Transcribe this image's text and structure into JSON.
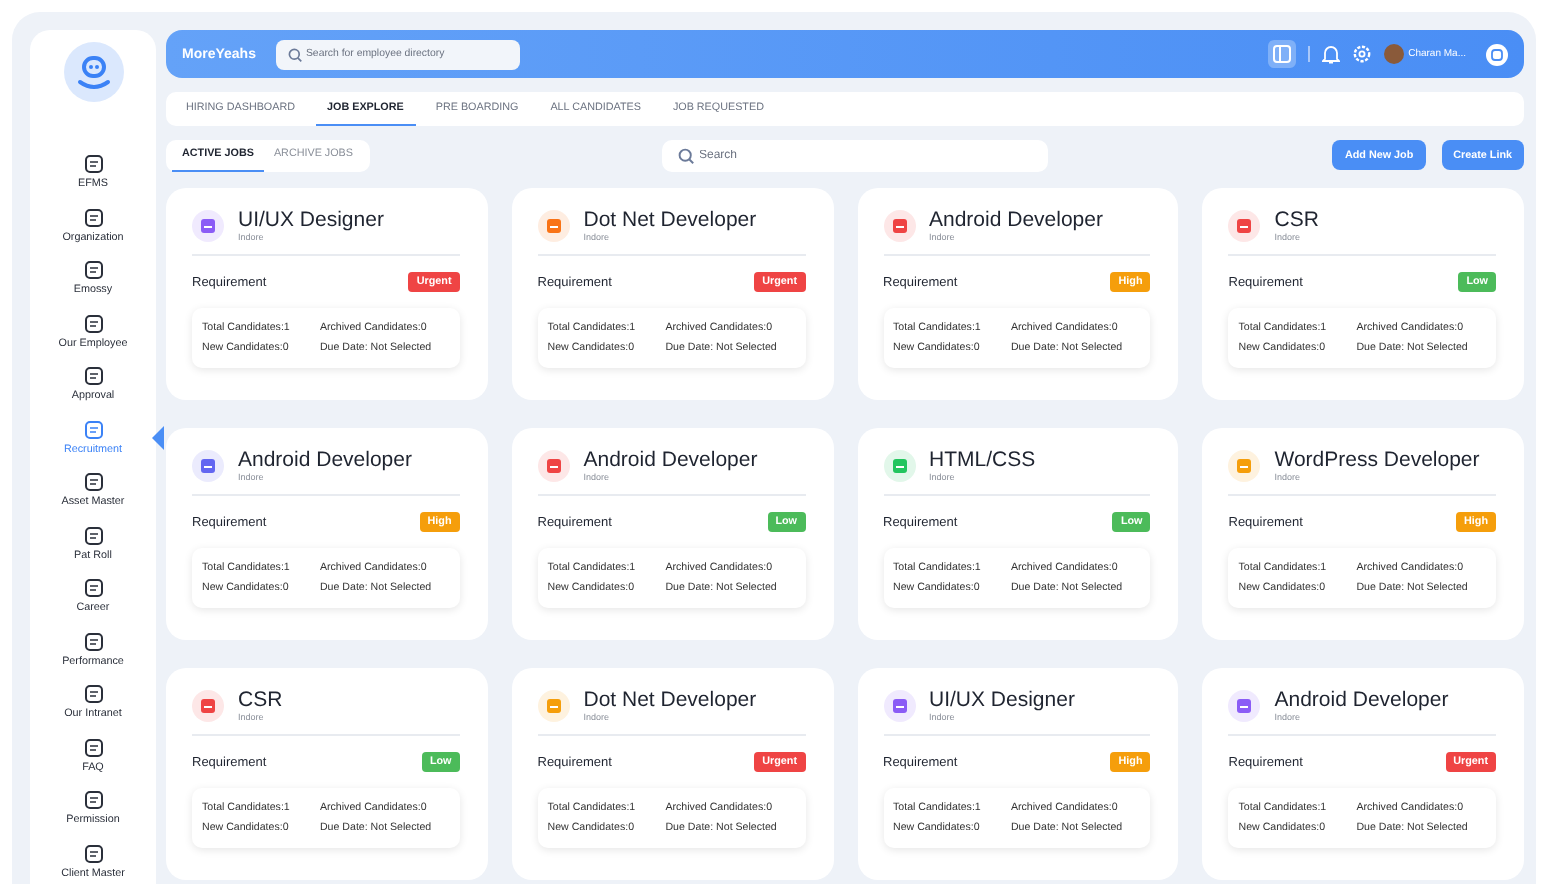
{
  "sidebar": {
    "items": [
      {
        "label": "EFMS",
        "selected": false
      },
      {
        "label": "Organization",
        "selected": false
      },
      {
        "label": "Emossy",
        "selected": false
      },
      {
        "label": "Our Employee",
        "selected": false
      },
      {
        "label": "Approval",
        "selected": false
      },
      {
        "label": "Recruitment",
        "selected": true
      },
      {
        "label": "Asset Master",
        "selected": false
      },
      {
        "label": "Pat Roll",
        "selected": false
      },
      {
        "label": "Career",
        "selected": false
      },
      {
        "label": "Performance",
        "selected": false
      },
      {
        "label": "Our Intranet",
        "selected": false
      },
      {
        "label": "FAQ",
        "selected": false
      },
      {
        "label": "Permission",
        "selected": false
      },
      {
        "label": "Client Master",
        "selected": false
      }
    ]
  },
  "header": {
    "brand": "MoreYeahs",
    "search": {
      "placeholder": "Search for employee directory"
    },
    "user_name": "Charan Ma..."
  },
  "tabs": [
    {
      "label": "HIRING DASHBOARD",
      "selected": false
    },
    {
      "label": "JOB EXPLORE",
      "selected": true
    },
    {
      "label": "PRE BOARDING",
      "selected": false
    },
    {
      "label": "ALL CANDIDATES",
      "selected": false
    },
    {
      "label": "JOB REQUESTED",
      "selected": false
    }
  ],
  "subtabs": [
    {
      "label": "ACTIVE JOBS",
      "selected": true
    },
    {
      "label": "ARCHIVE JOBS",
      "selected": false
    }
  ],
  "search": {
    "placeholder": "Search"
  },
  "buttons": [
    "Add New Job",
    "Create Link"
  ],
  "jobs": [
    {
      "title": "UI/UX Designer",
      "location": "Indore",
      "color": "#8b5cf6",
      "requirement": "Requirement",
      "priority": {
        "label": "Urgent",
        "kind": "urgent"
      },
      "stats": [
        "Total Candidates:1",
        "Archived Candidates:0",
        "New Candidates:0",
        "Due Date:  Not Selected"
      ]
    },
    {
      "title": "Dot Net Developer",
      "location": "Indore",
      "color": "#f97316",
      "requirement": "Requirement",
      "priority": {
        "label": "Urgent",
        "kind": "urgent"
      },
      "stats": [
        "Total Candidates:1",
        "Archived Candidates:0",
        "New Candidates:0",
        "Due Date:  Not Selected"
      ]
    },
    {
      "title": "Android Developer",
      "location": "Indore",
      "color": "#ef4444",
      "requirement": "Requirement",
      "priority": {
        "label": "High",
        "kind": "high"
      },
      "stats": [
        "Total Candidates:1",
        "Archived Candidates:0",
        "New Candidates:0",
        "Due Date:  Not Selected"
      ]
    },
    {
      "title": "CSR",
      "location": "Indore",
      "color": "#ef4444",
      "requirement": "Requirement",
      "priority": {
        "label": "Low",
        "kind": "low"
      },
      "stats": [
        "Total Candidates:1",
        "Archived Candidates:0",
        "New Candidates:0",
        "Due Date:  Not Selected"
      ]
    },
    {
      "title": "Android Developer",
      "location": "Indore",
      "color": "#6366f1",
      "requirement": "Requirement",
      "priority": {
        "label": "High",
        "kind": "high"
      },
      "stats": [
        "Total Candidates:1",
        "Archived Candidates:0",
        "New Candidates:0",
        "Due Date:  Not Selected"
      ]
    },
    {
      "title": "Android Developer",
      "location": "Indore",
      "color": "#ef4444",
      "requirement": "Requirement",
      "priority": {
        "label": "Low",
        "kind": "low"
      },
      "stats": [
        "Total Candidates:1",
        "Archived Candidates:0",
        "New Candidates:0",
        "Due Date:  Not Selected"
      ]
    },
    {
      "title": "HTML/CSS",
      "location": "Indore",
      "color": "#22c55e",
      "requirement": "Requirement",
      "priority": {
        "label": "Low",
        "kind": "low"
      },
      "stats": [
        "Total Candidates:1",
        "Archived Candidates:0",
        "New Candidates:0",
        "Due Date:  Not Selected"
      ]
    },
    {
      "title": "WordPress Developer",
      "location": "Indore",
      "color": "#f59e0b",
      "requirement": "Requirement",
      "priority": {
        "label": "High",
        "kind": "high"
      },
      "stats": [
        "Total Candidates:1",
        "Archived Candidates:0",
        "New Candidates:0",
        "Due Date:  Not Selected"
      ]
    },
    {
      "title": "CSR",
      "location": "Indore",
      "color": "#ef4444",
      "requirement": "Requirement",
      "priority": {
        "label": "Low",
        "kind": "low"
      },
      "stats": [
        "Total Candidates:1",
        "Archived Candidates:0",
        "New Candidates:0",
        "Due Date:  Not Selected"
      ]
    },
    {
      "title": "Dot Net Developer",
      "location": "Indore",
      "color": "#f59e0b",
      "requirement": "Requirement",
      "priority": {
        "label": "Urgent",
        "kind": "urgent"
      },
      "stats": [
        "Total Candidates:1",
        "Archived Candidates:0",
        "New Candidates:0",
        "Due Date:  Not Selected"
      ]
    },
    {
      "title": "UI/UX Designer",
      "location": "Indore",
      "color": "#8b5cf6",
      "requirement": "Requirement",
      "priority": {
        "label": "High",
        "kind": "high"
      },
      "stats": [
        "Total Candidates:1",
        "Archived Candidates:0",
        "New Candidates:0",
        "Due Date:  Not Selected"
      ]
    },
    {
      "title": "Android Developer",
      "location": "Indore",
      "color": "#8b5cf6",
      "requirement": "Requirement",
      "priority": {
        "label": "Urgent",
        "kind": "urgent"
      },
      "stats": [
        "Total Candidates:1",
        "Archived Candidates:0",
        "New Candidates:0",
        "Due Date:  Not Selected"
      ]
    }
  ]
}
